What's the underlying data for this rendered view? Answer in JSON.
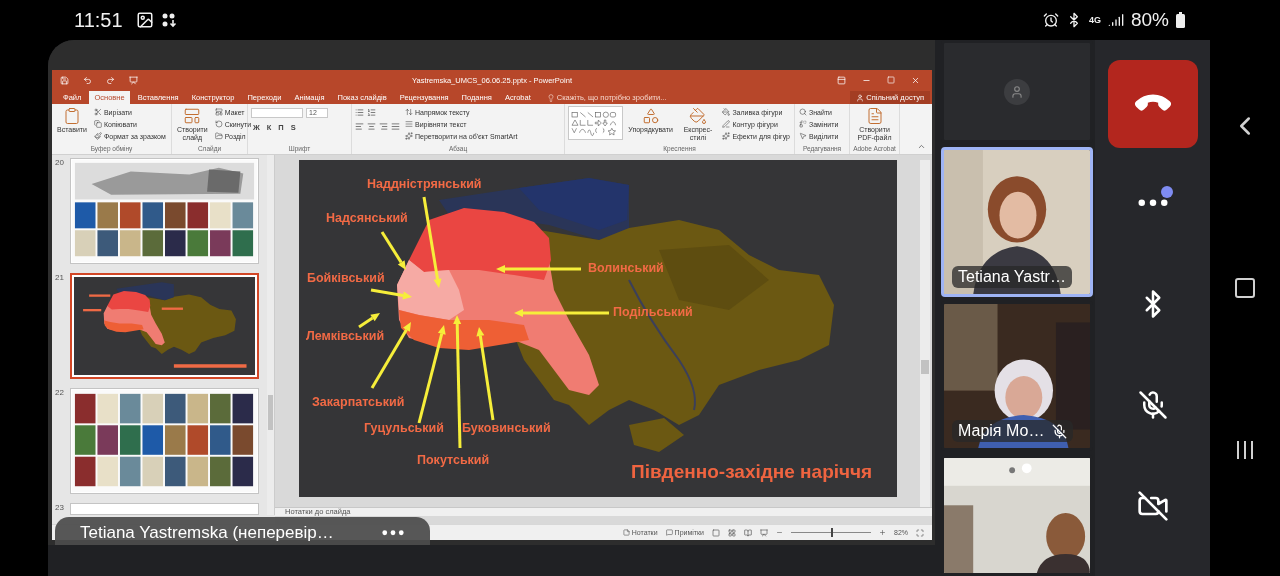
{
  "status_bar": {
    "time": "11:51",
    "network_type": "4G",
    "battery": "80%"
  },
  "powerpoint": {
    "title": "Yastremska_UMCS_06.06.25.pptx - PowerPoint",
    "tabs": [
      {
        "label": "Файл",
        "selected": false
      },
      {
        "label": "Основне",
        "selected": true
      },
      {
        "label": "Вставлення",
        "selected": false
      },
      {
        "label": "Конструктор",
        "selected": false
      },
      {
        "label": "Переходи",
        "selected": false
      },
      {
        "label": "Анімація",
        "selected": false
      },
      {
        "label": "Показ слайдів",
        "selected": false
      },
      {
        "label": "Рецензування",
        "selected": false
      },
      {
        "label": "Подання",
        "selected": false
      },
      {
        "label": "Acrobat",
        "selected": false
      }
    ],
    "tell_me": "Скажіть, що потрібно зробити...",
    "share": "Спільний доступ",
    "ribbon": [
      {
        "kind": "buttons",
        "label": "Буфер обміну",
        "large": [
          "Вставити"
        ],
        "small": [
          "Вирізати",
          "Копіювати",
          "Формат за зразком"
        ]
      },
      {
        "kind": "buttons",
        "label": "Слайди",
        "large": [
          "Створити слайд"
        ],
        "small": [
          "Макет",
          "Скинути",
          "Розділ"
        ]
      },
      {
        "kind": "font",
        "label": "Шрифт",
        "font_size": "12",
        "format_buttons": [
          "Ж",
          "К",
          "П",
          "S"
        ]
      },
      {
        "kind": "paragraph",
        "label": "Абзац",
        "small": [
          "Напрямок тексту",
          "Вирівняти текст",
          "Перетворити на об'єкт SmartArt"
        ]
      },
      {
        "kind": "drawing",
        "label": "Креслення",
        "large": [
          "Упорядкувати",
          "Експрес-стилі"
        ],
        "small": [
          "Заливка фігури",
          "Контур фігури",
          "Ефекти для фігур"
        ]
      },
      {
        "kind": "buttons",
        "label": "Редагування",
        "small": [
          "Знайти",
          "Замінити",
          "Виділити"
        ]
      },
      {
        "kind": "buttons",
        "label": "Adobe Acrobat",
        "large": [
          "Створити PDF-файл"
        ]
      }
    ],
    "slides": [
      {
        "number": "20",
        "selected": false
      },
      {
        "number": "21",
        "selected": true
      },
      {
        "number": "22",
        "selected": false
      },
      {
        "number": "23",
        "selected": false
      }
    ],
    "slide": {
      "labels": [
        "Наддністрянський",
        "Надсянський",
        "Бойківський",
        "Лемківський",
        "Закарпатський",
        "Гуцульський",
        "Покутський",
        "Буковинський",
        "Волинський",
        "Подільський"
      ],
      "title": "Південно-західне наріччя"
    },
    "notes_placeholder": "Нотатки до слайда",
    "status": {
      "notes": "Нотатки",
      "comments": "Примітки",
      "zoom": "82%",
      "level": 0.5
    }
  },
  "presenter": "Tetiana Yastremska (неперевір…",
  "participants": [
    {
      "kind": "avatar",
      "selected": false
    },
    {
      "kind": "video",
      "name": "Tetiana Yastr…",
      "selected": true,
      "muted": false
    },
    {
      "kind": "video",
      "name": "Марія Мо…",
      "selected": false,
      "muted": true
    },
    {
      "kind": "video",
      "selected": false
    }
  ],
  "controls": [
    {
      "kind": "hangup"
    },
    {
      "kind": "more",
      "badge": true
    },
    {
      "kind": "bluetooth"
    },
    {
      "kind": "mic_off"
    },
    {
      "kind": "camera_off"
    }
  ]
}
